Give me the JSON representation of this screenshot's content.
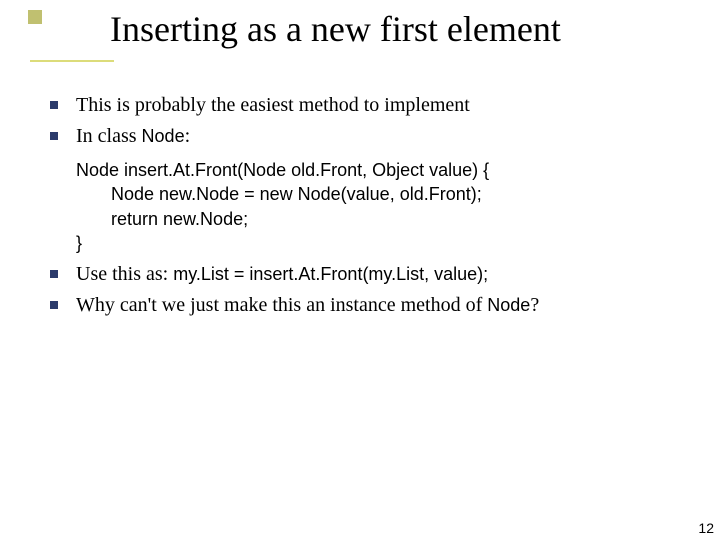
{
  "title": "Inserting as a new first element",
  "bullets": {
    "b1": "This is probably the easiest method to implement",
    "b2_prefix": "In class ",
    "b2_code": "Node",
    "b2_suffix": ":",
    "b3_prefix": "Use this as:  ",
    "b3_code": "my.List = insert.At.Front(my.List, value);",
    "b4_prefix": "Why can't we just make this an instance method of ",
    "b4_code": "Node",
    "b4_suffix": "?"
  },
  "code": {
    "l1": "Node insert.At.Front(Node old.Front, Object value) {",
    "l2": "       Node new.Node = new Node(value, old.Front);",
    "l3": "       return new.Node;",
    "l4": "}"
  },
  "page_number": "12"
}
